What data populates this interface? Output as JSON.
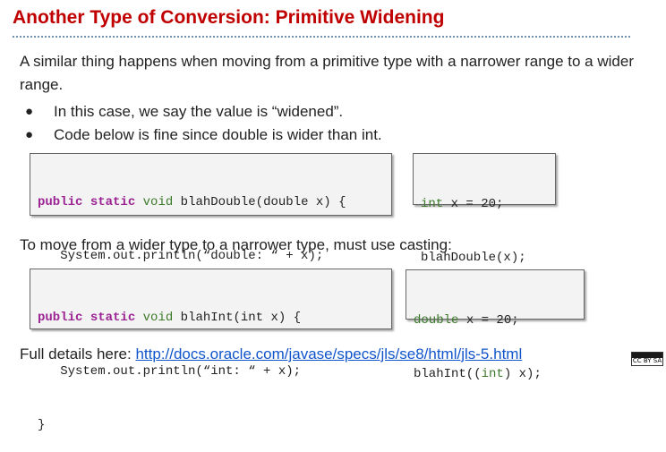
{
  "slide": {
    "title": "Another Type of Conversion: Primitive Widening",
    "intro": "A similar thing happens when moving from a primitive type with a narrower range to a wider range.",
    "bullets": [
      {
        "marker": "●",
        "text": "In this case, we say the value is “widened”."
      },
      {
        "marker": "●",
        "text": "Code below is fine since double is wider than int."
      }
    ],
    "casting_text": "To move from a wider type to a narrower type, must use casting:",
    "footer_prefix": "Full details here: ",
    "footer_link": "http://docs.oracle.com/javase/specs/jls/se8/html/jls-5.html",
    "license_badge": "CC BY SA"
  },
  "code": {
    "double_method": {
      "l1_kw1": "public",
      "l1_kw2": "static",
      "l1_ty": "void",
      "l1_rest": " blahDouble(double x) {",
      "l2": "   System.out.println(“double: “ + x);",
      "l3": "}"
    },
    "double_call": {
      "l1_ty": "int",
      "l1_rest": " x = 20;",
      "l2": "blahDouble(x);"
    },
    "int_method": {
      "l1_kw1": "public",
      "l1_kw2": "static",
      "l1_ty": "void",
      "l1_rest": " blahInt(int x) {",
      "l2": "   System.out.println(“int: “ + x);",
      "l3": "}"
    },
    "int_call": {
      "l1_ty": "double",
      "l1_rest": " x = 20;",
      "l2_pre": "blahInt((",
      "l2_ty": "int",
      "l2_post": ") x);"
    }
  },
  "colors": {
    "title": "#c00000",
    "keyword": "#9b2393",
    "type": "#3c7a2a",
    "link": "#1155cc",
    "code_bg": "#f3f3f3"
  }
}
